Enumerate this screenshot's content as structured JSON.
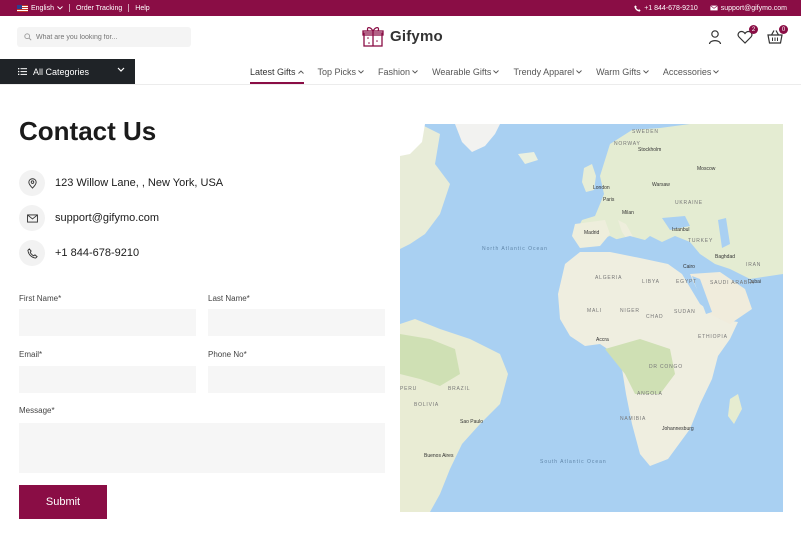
{
  "topbar": {
    "language": "English",
    "order_tracking": "Order Tracking",
    "help": "Help",
    "phone": "+1 844-678-9210",
    "email": "support@gifymo.com"
  },
  "header": {
    "search_placeholder": "What are you looking for...",
    "logo_text": "Gifymo",
    "wishlist_count": "2",
    "cart_count": "0"
  },
  "nav": {
    "all_categories": "All Categories",
    "items": [
      {
        "label": "Latest Gifts",
        "active": true
      },
      {
        "label": "Top Picks"
      },
      {
        "label": "Fashion"
      },
      {
        "label": "Wearable Gifts"
      },
      {
        "label": "Trendy Apparel"
      },
      {
        "label": "Warm Gifts"
      },
      {
        "label": "Accessories"
      }
    ]
  },
  "contact": {
    "title": "Contact Us",
    "address": "123 Willow Lane, , New York, USA",
    "email": "support@gifymo.com",
    "phone": "+1 844-678-9210"
  },
  "form": {
    "first_name_label": "First Name*",
    "last_name_label": "Last Name*",
    "email_label": "Email*",
    "phone_label": "Phone No*",
    "message_label": "Message*",
    "submit_label": "Submit"
  },
  "map": {
    "oceans": [
      "North Atlantic Ocean",
      "South Atlantic Ocean"
    ],
    "cities": [
      "Stockholm",
      "Moscow",
      "London",
      "Warsaw",
      "Paris",
      "Milan",
      "Madrid",
      "Istanbul",
      "Baghdad",
      "Cairo",
      "Dubai",
      "Accra",
      "Sao Paulo",
      "Buenos Aires",
      "Johannesburg"
    ],
    "countries": [
      "SWEDEN",
      "NORWAY",
      "UKRAINE",
      "TURKEY",
      "IRAN",
      "ALGERIA",
      "LIBYA",
      "EGYPT",
      "SAUDI ARABIA",
      "MALI",
      "NIGER",
      "CHAD",
      "SUDAN",
      "ETHIOPIA",
      "DR CONGO",
      "ANGOLA",
      "NAMIBIA",
      "BRAZIL",
      "BOLIVIA",
      "PERU"
    ]
  },
  "colors": {
    "brand": "#8a0d45",
    "dark": "#1f2327",
    "ocean": "#a9d0f2",
    "land": "#f2efe6"
  }
}
